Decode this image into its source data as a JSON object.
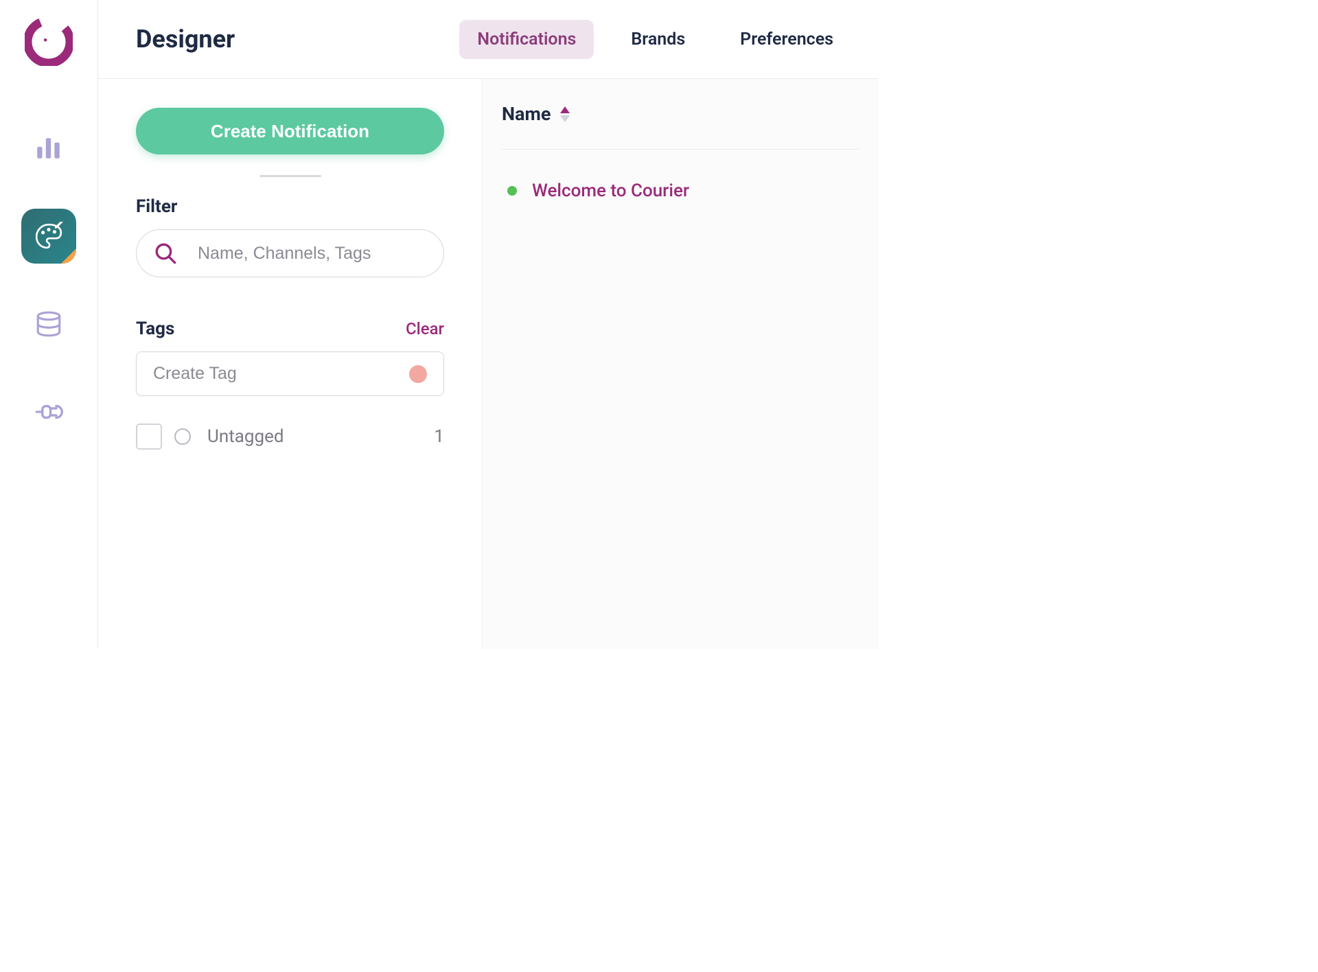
{
  "header": {
    "title": "Designer",
    "tabs": [
      {
        "label": "Notifications",
        "active": true
      },
      {
        "label": "Brands",
        "active": false
      },
      {
        "label": "Preferences",
        "active": false
      }
    ]
  },
  "sidebar": {
    "items": [
      {
        "name": "analytics",
        "active": false
      },
      {
        "name": "designer",
        "active": true
      },
      {
        "name": "data",
        "active": false
      },
      {
        "name": "integrations",
        "active": false
      }
    ]
  },
  "left_panel": {
    "create_button_label": "Create Notification",
    "filter_label": "Filter",
    "search_placeholder": "Name, Channels, Tags",
    "tags_label": "Tags",
    "clear_label": "Clear",
    "create_tag_placeholder": "Create Tag",
    "tag_color": "#f2a7a0",
    "tag_rows": [
      {
        "label": "Untagged",
        "count": "1"
      }
    ]
  },
  "list": {
    "column_header": "Name",
    "sort_direction": "asc",
    "rows": [
      {
        "status_color": "#54c054",
        "name": "Welcome to Courier"
      }
    ]
  },
  "colors": {
    "brand_primary": "#9b2a7a",
    "accent_green": "#5cc9a0",
    "rail_inactive": "#a9a3d6",
    "rail_active_bg": "#2a868b"
  }
}
